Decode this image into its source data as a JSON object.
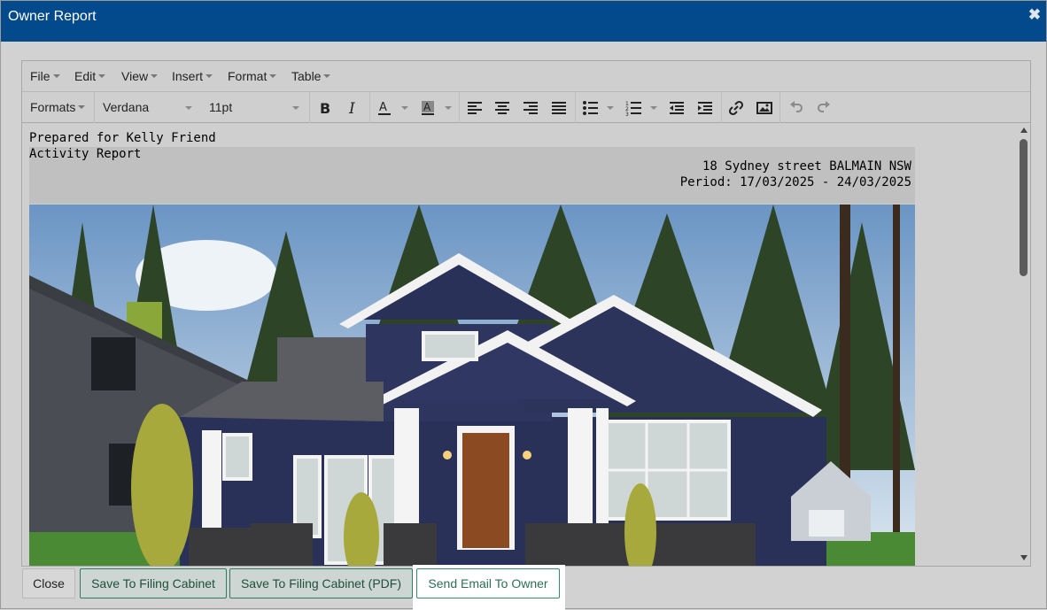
{
  "dialog": {
    "title": "Owner Report"
  },
  "menubar": {
    "items": [
      "File",
      "Edit",
      "View",
      "Insert",
      "Format",
      "Table"
    ]
  },
  "toolbar": {
    "formats_label": "Formats",
    "font_family": "Verdana",
    "font_size": "11pt"
  },
  "document": {
    "prepared_for": "Prepared for Kelly Friend",
    "report_type": "Activity Report",
    "address": "18 Sydney street BALMAIN NSW",
    "period": "Period: 17/03/2025 - 24/03/2025"
  },
  "buttons": {
    "close": "Close",
    "save_filing": "Save To Filing Cabinet",
    "save_filing_pdf": "Save To Filing Cabinet (PDF)",
    "send_email": "Send Email To Owner"
  },
  "colors": {
    "titlebar": "#034a8c",
    "accent_green": "#2e7d5e"
  }
}
